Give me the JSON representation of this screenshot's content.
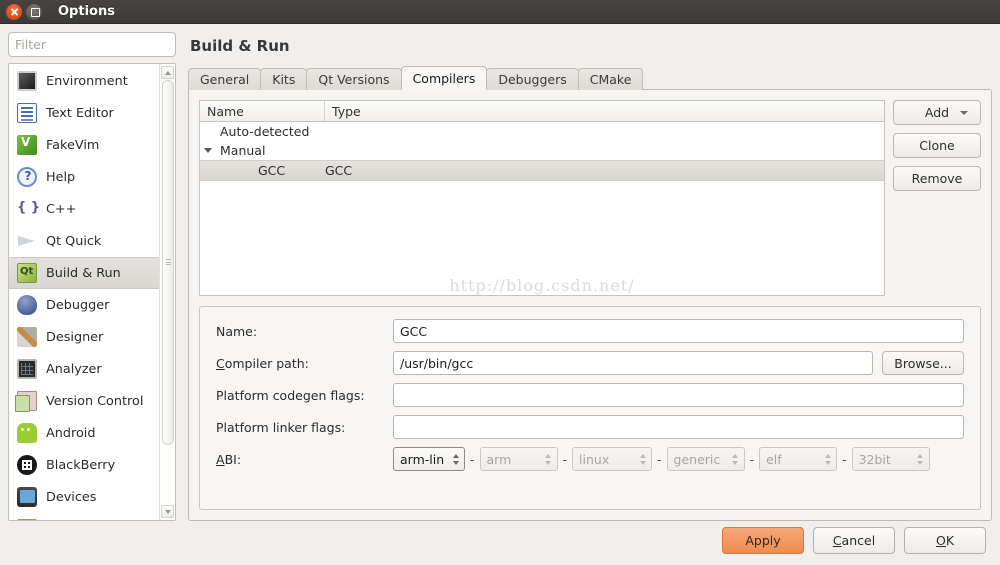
{
  "window": {
    "title": "Options",
    "close_icon": "close-icon",
    "maximize_icon": "maximize-icon"
  },
  "sidebar": {
    "filter_placeholder": "Filter",
    "filter_value": "",
    "items": [
      {
        "label": "Environment",
        "icon": "environment-icon",
        "selected": false
      },
      {
        "label": "Text Editor",
        "icon": "text-editor-icon",
        "selected": false
      },
      {
        "label": "FakeVim",
        "icon": "fakevim-icon",
        "selected": false
      },
      {
        "label": "Help",
        "icon": "help-icon",
        "selected": false
      },
      {
        "label": "C++",
        "icon": "cpp-icon",
        "selected": false
      },
      {
        "label": "Qt Quick",
        "icon": "qt-quick-icon",
        "selected": false
      },
      {
        "label": "Build & Run",
        "icon": "build-and-run-icon",
        "selected": true
      },
      {
        "label": "Debugger",
        "icon": "debugger-icon",
        "selected": false
      },
      {
        "label": "Designer",
        "icon": "designer-icon",
        "selected": false
      },
      {
        "label": "Analyzer",
        "icon": "analyzer-icon",
        "selected": false
      },
      {
        "label": "Version Control",
        "icon": "version-control-icon",
        "selected": false
      },
      {
        "label": "Android",
        "icon": "android-icon",
        "selected": false
      },
      {
        "label": "BlackBerry",
        "icon": "blackberry-icon",
        "selected": false
      },
      {
        "label": "Devices",
        "icon": "devices-icon",
        "selected": false
      }
    ]
  },
  "page": {
    "title": "Build & Run",
    "tabs": [
      {
        "label": "General",
        "active": false
      },
      {
        "label": "Kits",
        "active": false
      },
      {
        "label": "Qt Versions",
        "active": false
      },
      {
        "label": "Compilers",
        "active": true
      },
      {
        "label": "Debuggers",
        "active": false
      },
      {
        "label": "CMake",
        "active": false
      }
    ]
  },
  "compilers_table": {
    "columns": [
      "Name",
      "Type"
    ],
    "rows": [
      {
        "name": "Auto-detected",
        "type": "",
        "level": 0,
        "expander": "",
        "selected": false
      },
      {
        "name": "Manual",
        "type": "",
        "level": 0,
        "expander": "▼",
        "selected": false
      },
      {
        "name": "GCC",
        "type": "GCC",
        "level": 1,
        "expander": "",
        "selected": true
      }
    ],
    "watermark": "http://blog.csdn.net/"
  },
  "side_buttons": {
    "add": "Add",
    "add_caret_icon": "chevron-down-icon",
    "clone": "Clone",
    "remove": "Remove"
  },
  "details_form": {
    "name_label": "Name:",
    "name_value": "GCC",
    "compiler_path_label": "Compiler path:",
    "compiler_path_value": "/usr/bin/gcc",
    "browse_label": "Browse...",
    "codegen_label": "Platform codegen flags:",
    "codegen_value": "",
    "linker_label": "Platform linker flags:",
    "linker_value": "",
    "abi_label": "ABI:",
    "abi_separator": "-",
    "abi_parts": [
      {
        "value": "arm-lin",
        "enabled": true,
        "name": "abi-full-combo"
      },
      {
        "value": "arm",
        "enabled": false,
        "name": "abi-architecture-combo"
      },
      {
        "value": "linux",
        "enabled": false,
        "name": "abi-os-combo"
      },
      {
        "value": "generic",
        "enabled": false,
        "name": "abi-os-flavor-combo"
      },
      {
        "value": "elf",
        "enabled": false,
        "name": "abi-binary-format-combo"
      },
      {
        "value": "32bit",
        "enabled": false,
        "name": "abi-word-width-combo"
      }
    ]
  },
  "footer": {
    "apply": "Apply",
    "cancel": "Cancel",
    "ok": "OK"
  },
  "colors": {
    "titlebar": "#3b3a36",
    "window_bg": "#f0efed",
    "apply_accent": "#ef8b4f",
    "close_button": "#dd4814",
    "watermark": "#dcdcdc"
  }
}
